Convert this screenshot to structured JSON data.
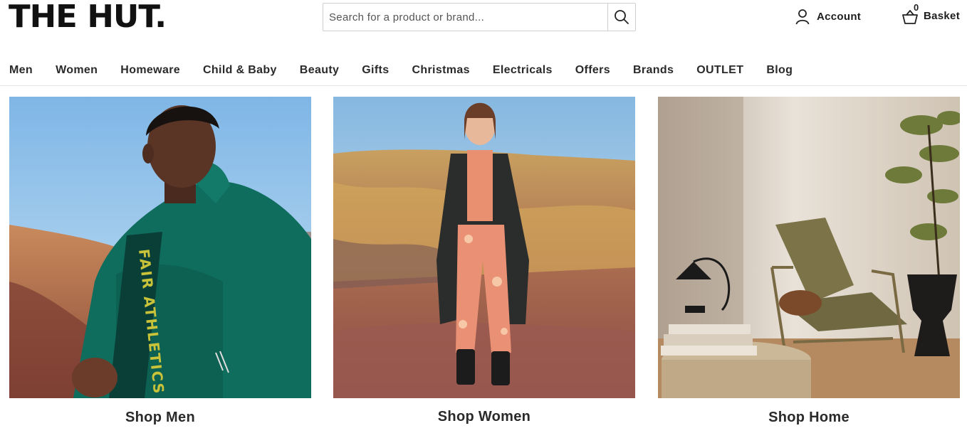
{
  "header": {
    "logo": "THE HUT.",
    "search": {
      "placeholder": "Search for a product or brand..."
    },
    "account_label": "Account",
    "basket": {
      "count": "0",
      "label": "Basket"
    }
  },
  "nav": {
    "items": [
      "Men",
      "Women",
      "Homeware",
      "Child & Baby",
      "Beauty",
      "Gifts",
      "Christmas",
      "Electricals",
      "Offers",
      "Brands",
      "OUTLET",
      "Blog"
    ]
  },
  "promos": [
    {
      "caption": "Shop Men",
      "jacket_text": "FAIR ATHLETICS"
    },
    {
      "caption": "Shop Women"
    },
    {
      "caption": "Shop Home"
    }
  ],
  "colors": {
    "text": "#1e1e1e",
    "border": "#cfcfcf",
    "jacket": "#0f6d5e",
    "sky": "#a9d1ee"
  },
  "icons": [
    "search-icon",
    "user-icon",
    "basket-icon"
  ]
}
